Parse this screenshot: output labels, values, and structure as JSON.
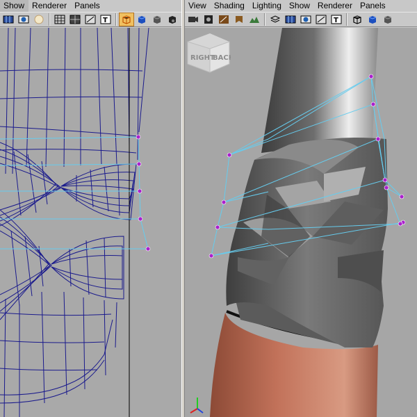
{
  "left_panel": {
    "menu": [
      "Show",
      "Renderer",
      "Panels"
    ],
    "viewport": "wireframe"
  },
  "right_panel": {
    "menu": [
      "View",
      "Shading",
      "Lighting",
      "Show",
      "Renderer",
      "Panels"
    ],
    "viewport": "smooth-shaded",
    "viewcube": {
      "right_label": "RIGHT",
      "back_label": "BACK"
    }
  },
  "toolbar_icons": {
    "left": [
      "grid-icon",
      "camera-icon",
      "sphere-icon",
      "wireframe-icon",
      "smooth-shade-icon",
      "bounding-box-icon",
      "text-icon",
      "isolate-cube-icon",
      "cube-blue-icon",
      "cube-dark-icon",
      "cube-black-icon",
      "light-bulb-icon",
      "cube-light-icon"
    ],
    "right": [
      "camera-icon",
      "film-icon",
      "bookmark-icon",
      "terrain-icon",
      "layers-icon",
      "grid-icon",
      "sphere-icon",
      "bounding-box-icon",
      "text-icon",
      "isolate-cube-icon",
      "cube-blue-icon",
      "cube-dark-icon"
    ]
  },
  "colors": {
    "wireframe": "#1a1a8c",
    "lattice": "#66ccee",
    "lattice_point": "#aa22cc",
    "skin": "#c2725a",
    "wrap": "#6f6f6f"
  }
}
